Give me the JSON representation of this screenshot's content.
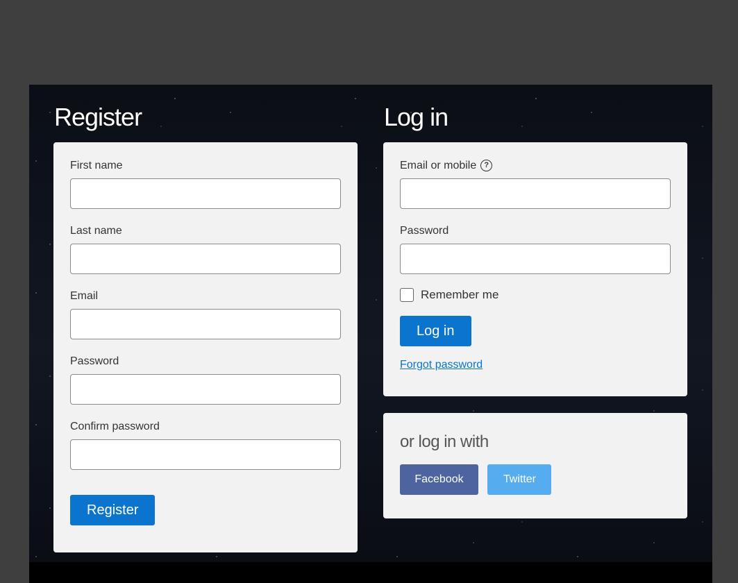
{
  "register": {
    "title": "Register",
    "fields": [
      {
        "label": "First name",
        "value": ""
      },
      {
        "label": "Last name",
        "value": ""
      },
      {
        "label": "Email",
        "value": ""
      },
      {
        "label": "Password",
        "value": ""
      },
      {
        "label": "Confirm password",
        "value": ""
      }
    ],
    "submit_label": "Register"
  },
  "login": {
    "title": "Log in",
    "email_label": "Email or mobile",
    "help_icon": "question-circle-icon",
    "password_label": "Password",
    "remember_label": "Remember me",
    "remember_checked": false,
    "submit_label": "Log in",
    "forgot_label": "Forgot password"
  },
  "social": {
    "title": "or log in with",
    "facebook_label": "Facebook",
    "twitter_label": "Twitter"
  },
  "colors": {
    "primary": "#0a74cf",
    "facebook": "#4d64a1",
    "twitter": "#55acee",
    "panel": "#f2f2f2",
    "page_background": "#3f3f3f"
  }
}
